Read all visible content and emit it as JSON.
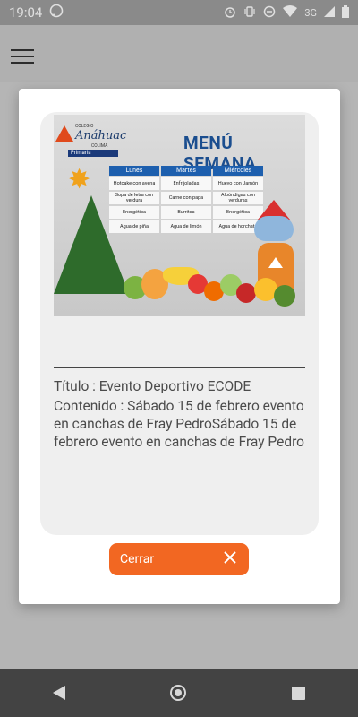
{
  "status_bar": {
    "time": "19:04",
    "network": "3G"
  },
  "banner": {
    "logo_small": "COLEGIO",
    "logo_name": "Anáhuac",
    "logo_city": "COLIMA",
    "logo_level": "Primaria",
    "title": "MENÚ SEMANA",
    "days": [
      "Lunes",
      "Martes",
      "Miércoles"
    ],
    "rows": [
      [
        "Hotcake con avena",
        "Enfrijoladas",
        "Huevo con Jamón"
      ],
      [
        "Sopa de letra con verdura",
        "Carne con papa",
        "Albóndigas con verduras"
      ],
      [
        "Energética",
        "Burritos",
        "Energética"
      ],
      [
        "Agua de piña",
        "Agua de limón",
        "Agua de horchata"
      ]
    ]
  },
  "notice": {
    "title_line": "Título : Evento Deportivo ECODE",
    "content_line": "Contenido : Sábado 15 de febrero evento en canchas de Fray PedroSábado 15 de febrero evento en canchas de Fray Pedro"
  },
  "close_button": {
    "label": "Cerrar"
  }
}
